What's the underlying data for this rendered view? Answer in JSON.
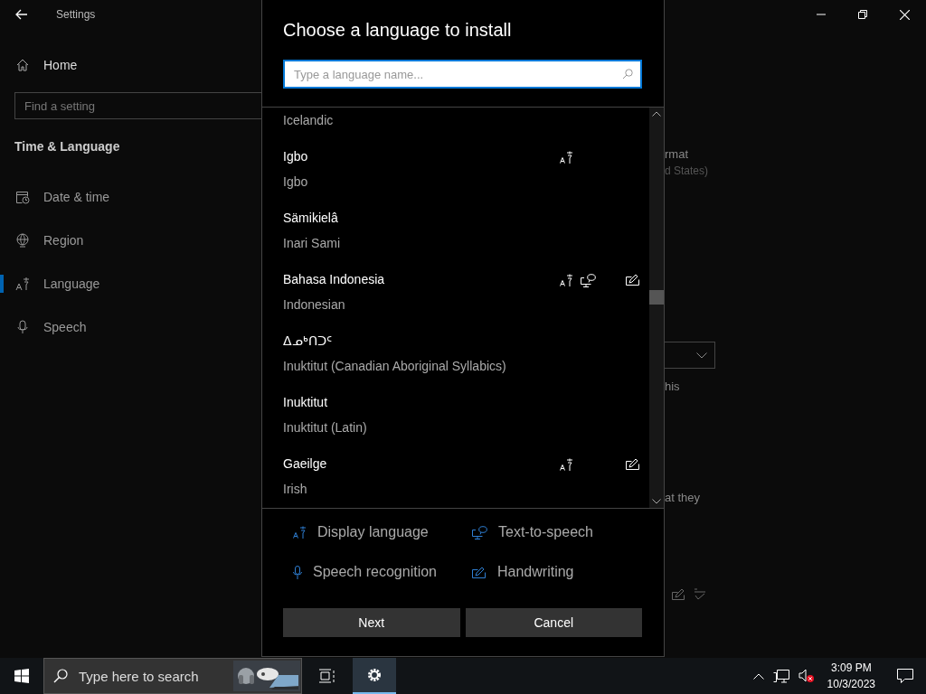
{
  "window": {
    "title": "Settings"
  },
  "sidebar": {
    "home": "Home",
    "search_placeholder": "Find a setting",
    "section": "Time & Language",
    "items": [
      {
        "label": "Date & time",
        "selected": false
      },
      {
        "label": "Region",
        "selected": false
      },
      {
        "label": "Language",
        "selected": true
      },
      {
        "label": "Speech",
        "selected": false
      }
    ]
  },
  "background_fragments": {
    "line_1": "rmat",
    "line_2": "d States)",
    "line_3": "his",
    "line_4": "at they"
  },
  "dialog": {
    "title": "Choose a language to install",
    "search_placeholder": "Type a language name...",
    "languages": [
      {
        "english": "Icelandic"
      },
      {
        "native": "Igbo",
        "english": "Igbo",
        "display": true,
        "tts": false,
        "speech": false,
        "handwriting": false
      },
      {
        "native": "Sämikielâ",
        "english": "Inari Sami",
        "display": false,
        "tts": false,
        "speech": false,
        "handwriting": false
      },
      {
        "native": "Bahasa Indonesia",
        "english": "Indonesian",
        "display": true,
        "tts": true,
        "speech": false,
        "handwriting": true
      },
      {
        "native": "ᐃᓄᒃᑎᑐᑦ",
        "english": "Inuktitut (Canadian Aboriginal Syllabics)",
        "display": false,
        "tts": false,
        "speech": false,
        "handwriting": false
      },
      {
        "native": "Inuktitut",
        "english": "Inuktitut (Latin)",
        "display": false,
        "tts": false,
        "speech": false,
        "handwriting": false
      },
      {
        "native": "Gaeilge",
        "english": "Irish",
        "display": true,
        "tts": false,
        "speech": false,
        "handwriting": true
      }
    ],
    "legend": [
      {
        "kind": "display",
        "label": "Display language"
      },
      {
        "kind": "tts",
        "label": "Text-to-speech"
      },
      {
        "kind": "speech",
        "label": "Speech recognition"
      },
      {
        "kind": "handwriting",
        "label": "Handwriting"
      }
    ],
    "buttons": [
      "Next",
      "Cancel"
    ]
  },
  "taskbar": {
    "search_placeholder": "Type here to search",
    "time": "3:09 PM",
    "date": "10/3/2023"
  }
}
